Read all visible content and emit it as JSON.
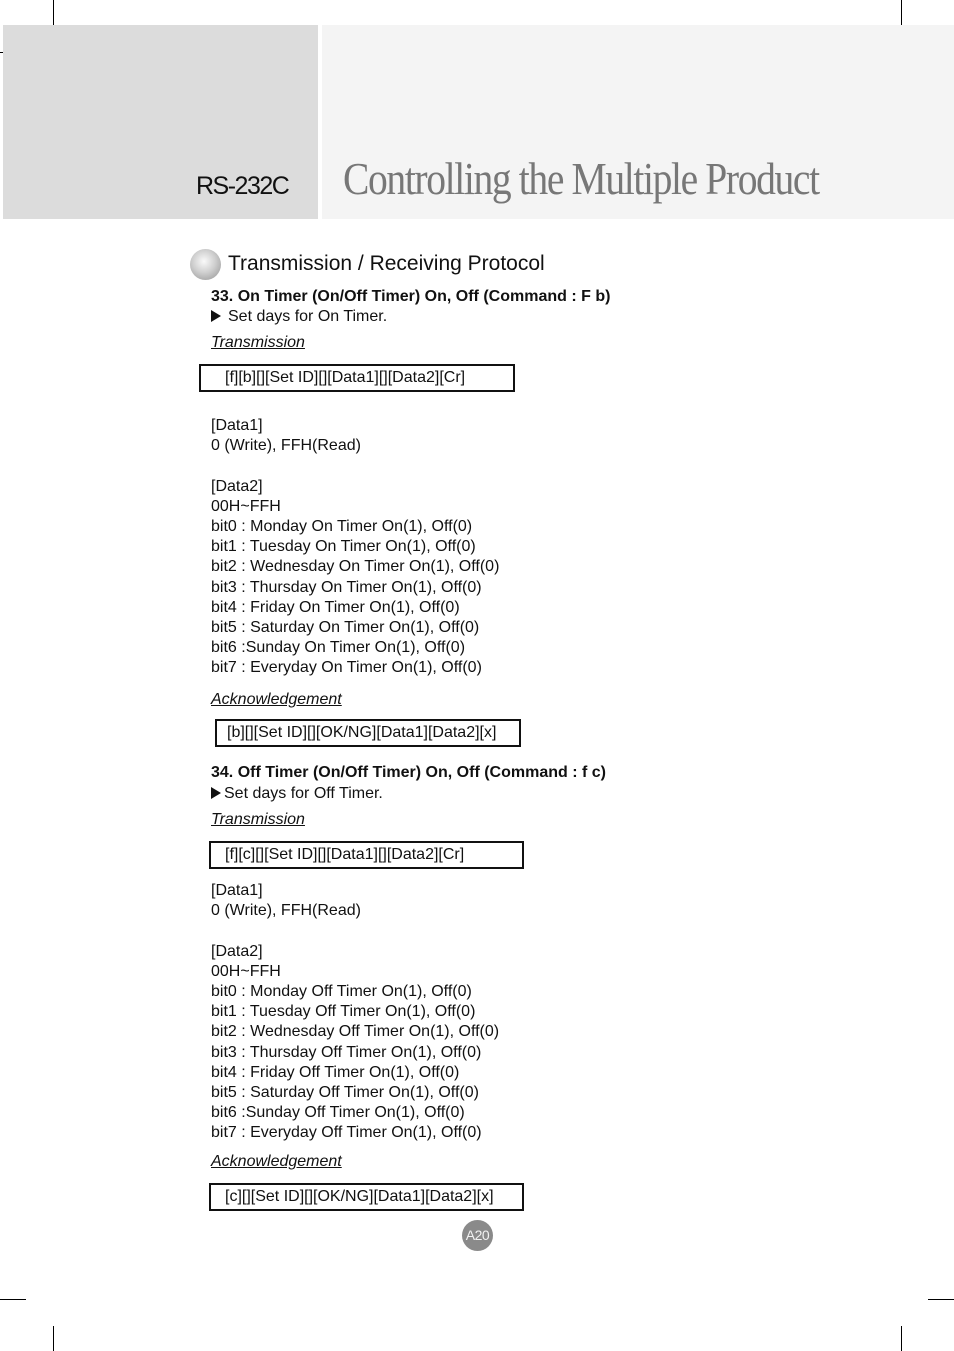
{
  "header": {
    "section_label": "RS-232C",
    "page_title": "Controlling the Multiple Product"
  },
  "protocol_heading": "Transmission / Receiving Protocol",
  "commands": [
    {
      "title": "33. On Timer (On/Off Timer) On, Off (Command : F b)",
      "note": "Set days for On Timer.",
      "transmission_label": "Transmission",
      "transmission_packet": "[f][b][][Set ID][][Data1][][Data2][Cr]",
      "data_lines": [
        "[Data1]",
        "0 (Write), FFH(Read)",
        "",
        "[Data2]",
        "00H~FFH",
        "bit0 : Monday On Timer On(1), Off(0)",
        "bit1 : Tuesday On Timer On(1), Off(0)",
        "bit2 : Wednesday On Timer On(1), Off(0)",
        "bit3 : Thursday On Timer On(1), Off(0)",
        "bit4 : Friday On Timer On(1), Off(0)",
        "bit5 : Saturday On Timer On(1), Off(0)",
        "bit6 :Sunday On Timer On(1), Off(0)",
        "bit7 : Everyday On Timer On(1), Off(0)"
      ],
      "acknowledgement_label": "Acknowledgement",
      "acknowledgement_packet": "[b][][Set ID][][OK/NG][Data1][Data2][x]"
    },
    {
      "title": "34. Off Timer (On/Off Timer) On, Off (Command : f c)",
      "note": "Set days for Off Timer.",
      "transmission_label": "Transmission",
      "transmission_packet": "[f][c][][Set ID][][Data1][][Data2][Cr]",
      "data_lines": [
        "[Data1]",
        "0 (Write), FFH(Read)",
        "",
        "[Data2]",
        "00H~FFH",
        "bit0 : Monday Off Timer On(1), Off(0)",
        "bit1 : Tuesday Off Timer On(1), Off(0)",
        "bit2 : Wednesday Off Timer On(1), Off(0)",
        "bit3 : Thursday Off Timer On(1), Off(0)",
        "bit4 : Friday Off Timer On(1), Off(0)",
        "bit5 : Saturday Off Timer On(1), Off(0)",
        "bit6 :Sunday Off Timer On(1), Off(0)",
        "bit7 : Everyday Off Timer On(1), Off(0)"
      ],
      "acknowledgement_label": "Acknowledgement",
      "acknowledgement_packet": "[c][][Set ID][][OK/NG][Data1][Data2][x]"
    }
  ],
  "footer": {
    "page_number": "A20"
  }
}
